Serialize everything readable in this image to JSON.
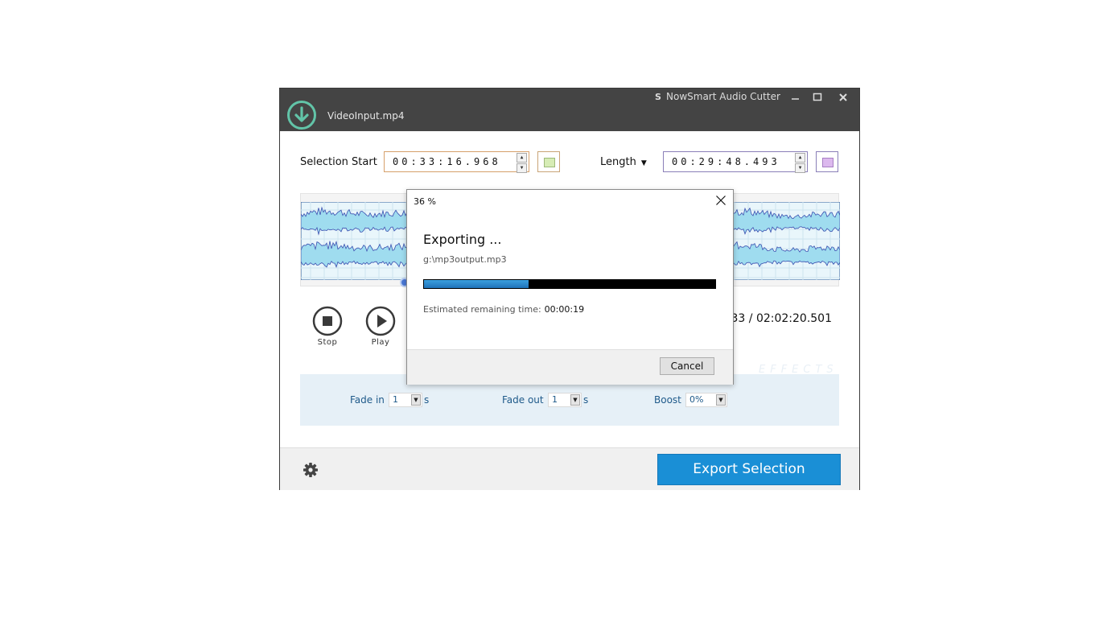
{
  "window": {
    "file_name": "VideoInput.mp4",
    "app_title": "NowSmart Audio Cutter",
    "app_icon": "S"
  },
  "selection": {
    "start_label": "Selection Start",
    "start_value": "00:33:16.968",
    "length_label": "Length",
    "length_value": "00:29:48.493",
    "start_color": "#d6ecb5",
    "length_color": "#dcb9ee"
  },
  "transport": {
    "stop_label": "Stop",
    "play_label": "Play",
    "time_counter": "33 / 02:02:20.501"
  },
  "effects": {
    "ghost_label": "EFFECTS",
    "fade_in_label": "Fade in",
    "fade_in_value": "1",
    "fade_out_label": "Fade out",
    "fade_out_value": "1",
    "unit": "s",
    "boost_label": "Boost",
    "boost_value": "0%"
  },
  "footer": {
    "export_label": "Export Selection",
    "accent_color": "#1a8fd6"
  },
  "dialog": {
    "title": "36 %",
    "heading": "Exporting ...",
    "path": "g:\\mp3output.mp3",
    "progress_percent": 36,
    "remaining_label": "Estimated remaining time:",
    "remaining_value": "00:00:19",
    "cancel_label": "Cancel"
  }
}
